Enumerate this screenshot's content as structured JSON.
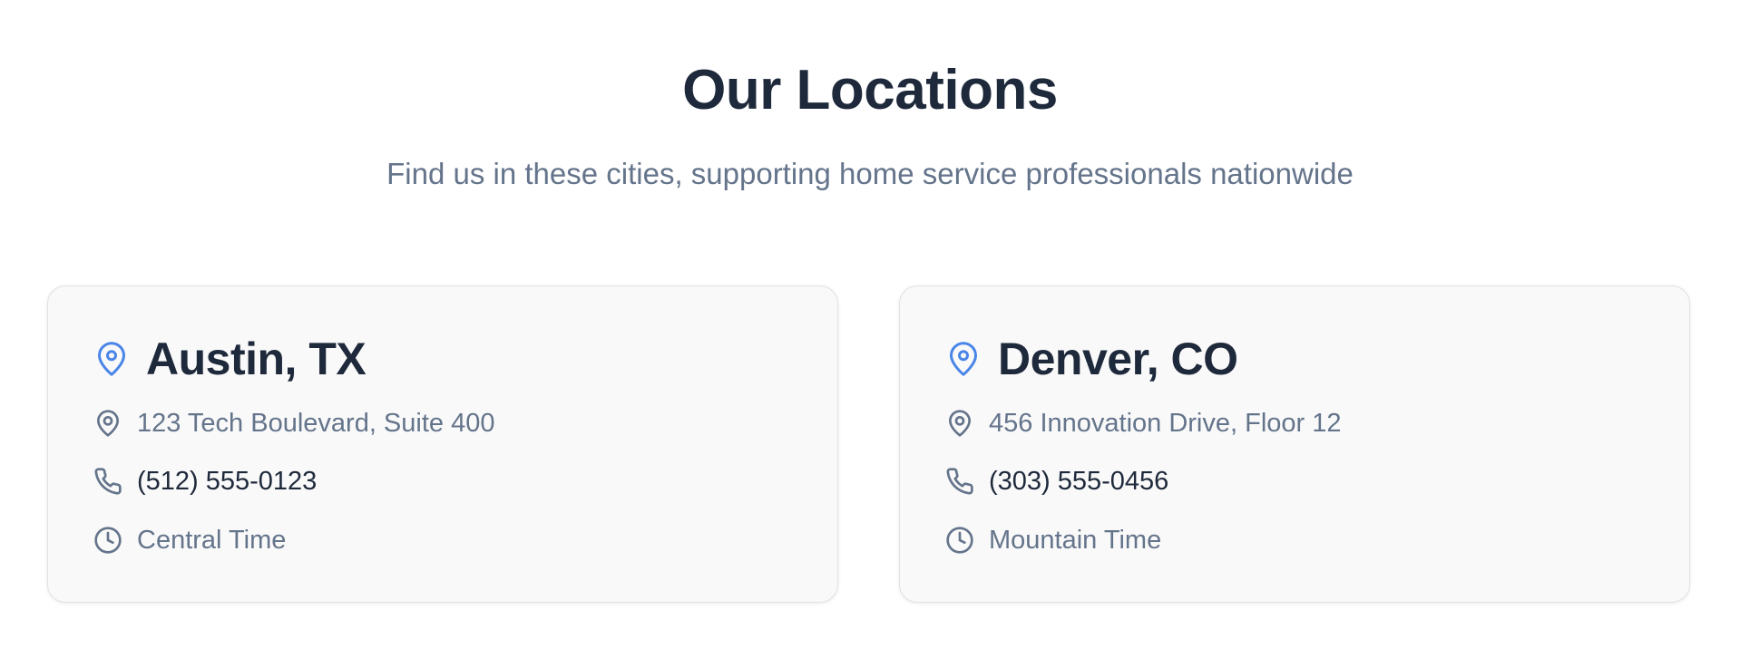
{
  "header": {
    "title": "Our Locations",
    "subtitle": "Find us in these cities, supporting home service professionals nationwide"
  },
  "locations": [
    {
      "city": "Austin, TX",
      "address": "123 Tech Boulevard, Suite 400",
      "phone": "(512) 555-0123",
      "timezone": "Central Time"
    },
    {
      "city": "Denver, CO",
      "address": "456 Innovation Drive, Floor 12",
      "phone": "(303) 555-0456",
      "timezone": "Mountain Time"
    }
  ],
  "icons": {
    "header_pin": "map-pin-icon",
    "address": "map-pin-icon",
    "phone": "phone-icon",
    "time": "clock-icon"
  },
  "colors": {
    "accent": "#4a86e8",
    "heading": "#1e293b",
    "muted": "#64748b",
    "card_background": "#f9f9f9",
    "card_border": "#e2e2e2"
  }
}
